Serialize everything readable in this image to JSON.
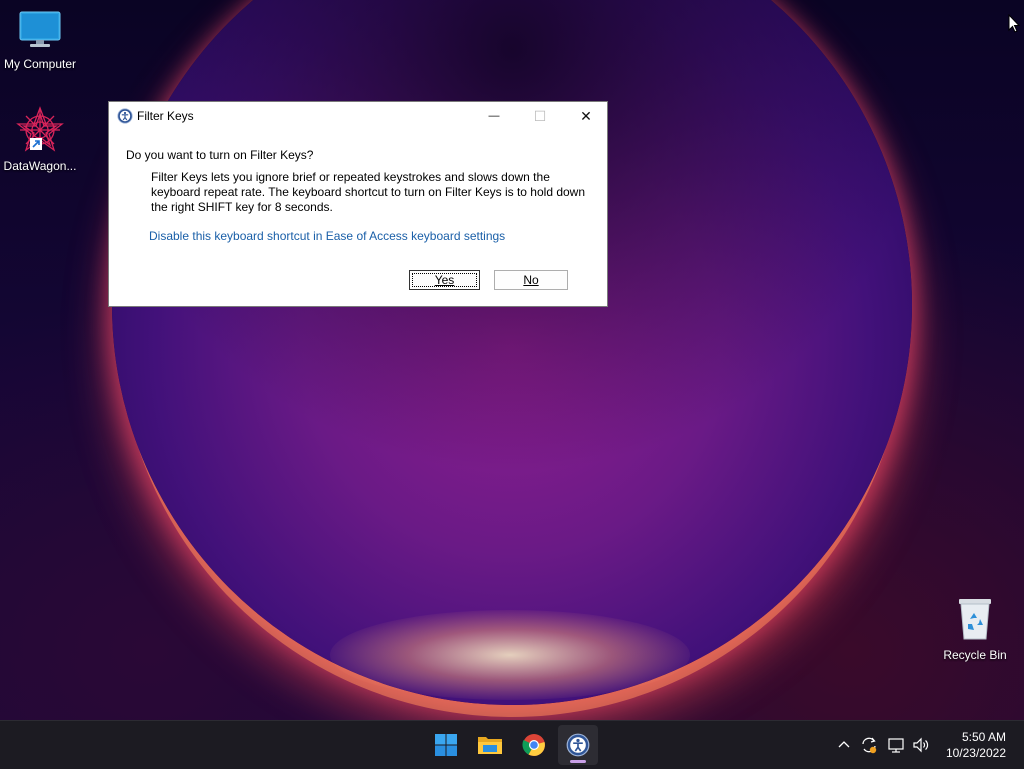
{
  "desktop": {
    "icons": [
      {
        "label": "My Computer"
      },
      {
        "label": "DataWagon..."
      },
      {
        "label": "Recycle Bin"
      }
    ]
  },
  "dialog": {
    "title": "Filter Keys",
    "question": "Do you want to turn on Filter Keys?",
    "description": "Filter Keys lets you ignore brief or repeated keystrokes and slows down the keyboard repeat rate.  The keyboard shortcut to turn on Filter Keys is to hold down the right SHIFT key for 8 seconds.",
    "link": "Disable this keyboard shortcut in Ease of Access keyboard settings",
    "yes_label": "Yes",
    "no_label": "No",
    "window_controls": {
      "minimize": "—",
      "maximize": "☐",
      "close": "✕"
    }
  },
  "taskbar": {
    "apps": [
      {
        "icon": "windows-start-icon"
      },
      {
        "icon": "file-explorer-icon"
      },
      {
        "icon": "chrome-icon"
      },
      {
        "icon": "accessibility-icon",
        "active": true
      }
    ],
    "tray_icons": [
      "chevron-up-icon",
      "sync-icon",
      "network-icon",
      "volume-icon"
    ],
    "time": "5:50 AM",
    "date": "10/23/2022"
  },
  "colors": {
    "link": "#1a5fa8",
    "taskbar": "#1c1b22",
    "desktop_bg": "#0c0526"
  }
}
